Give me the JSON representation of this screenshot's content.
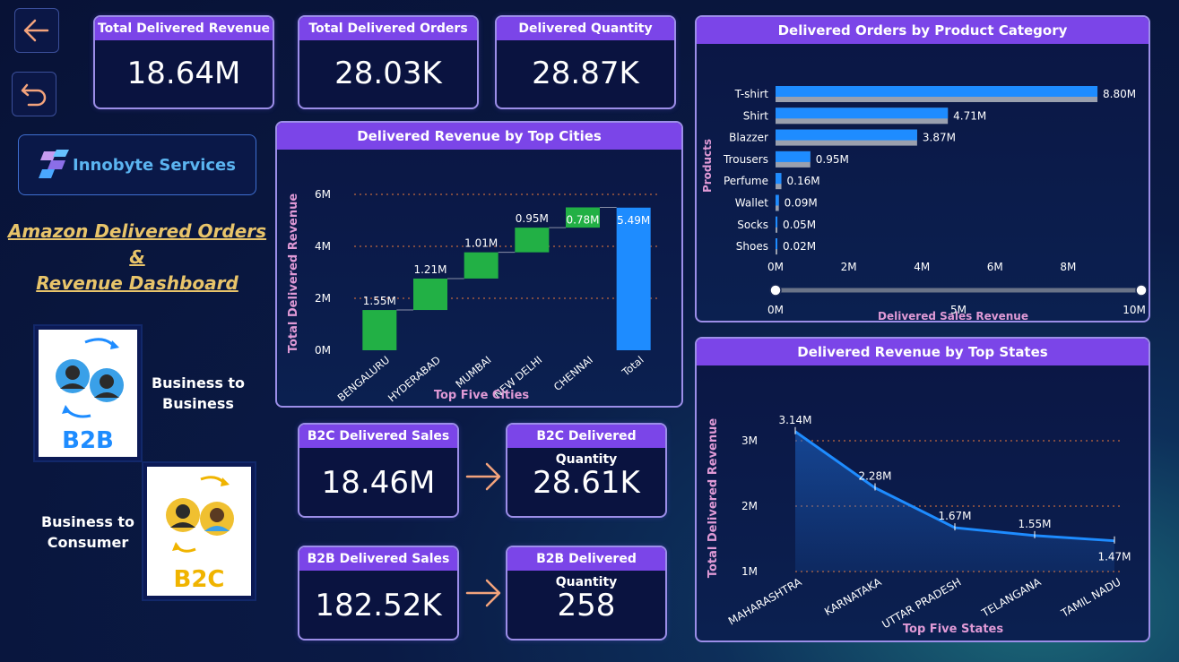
{
  "kpis": {
    "total_revenue": {
      "label": "Total Delivered Revenue",
      "value": "18.64M"
    },
    "total_orders": {
      "label": "Total Delivered Orders",
      "value": "28.03K"
    },
    "delivered_quantity": {
      "label": "Delivered Quantity",
      "value": "28.87K"
    },
    "b2c_sales": {
      "label": "B2C Delivered Sales",
      "value": "18.46M"
    },
    "b2c_quantity": {
      "label": "B2C Delivered Quantity",
      "value": "28.61K"
    },
    "b2b_sales": {
      "label": "B2B Delivered Sales",
      "value": "182.52K"
    },
    "b2b_quantity": {
      "label": "B2B Delivered Quantity",
      "value": "258"
    }
  },
  "brand": {
    "logo_text": "Innobyte Services"
  },
  "dashboard_title": {
    "line1": "Amazon Delivered Orders &",
    "line2": "Revenue Dashboard"
  },
  "b2b": {
    "badge": "B2B",
    "label_line1": "Business to",
    "label_line2": "Business"
  },
  "b2c": {
    "badge": "B2C",
    "label_line1": "Business to",
    "label_line2": "Consumer"
  },
  "colors": {
    "accent": "#7b45e8",
    "bar_blue": "#1e8cff",
    "bar_green": "#22b045",
    "gold": "#e8c46a"
  },
  "chart_data": [
    {
      "id": "cities",
      "type": "bar",
      "subtype": "waterfall",
      "title": "Delivered Revenue by Top Cities",
      "xlabel": "Top Five Cities",
      "ylabel": "Total Delivered Revenue",
      "categories": [
        "BENGALURU",
        "HYDERABAD",
        "MUMBAI",
        "NEW DELHI",
        "CHENNAI",
        "Total"
      ],
      "values": [
        1.55,
        1.21,
        1.01,
        0.95,
        0.78,
        5.49
      ],
      "labels": [
        "1.55M",
        "1.21M",
        "1.01M",
        "0.95M",
        "0.78M",
        "5.49M"
      ],
      "ylim": [
        0,
        6
      ],
      "yticks": [
        "0M",
        "2M",
        "4M",
        "6M"
      ]
    },
    {
      "id": "products",
      "type": "bar",
      "orientation": "horizontal",
      "title": "Delivered Orders by Product Category",
      "xlabel": "Delivered Sales Revenue",
      "ylabel": "Products",
      "categories": [
        "T-shirt",
        "Shirt",
        "Blazzer",
        "Trousers",
        "Perfume",
        "Wallet",
        "Socks",
        "Shoes"
      ],
      "values": [
        8.8,
        4.71,
        3.87,
        0.95,
        0.16,
        0.09,
        0.05,
        0.02
      ],
      "labels": [
        "8.80M",
        "4.71M",
        "3.87M",
        "0.95M",
        "0.16M",
        "0.09M",
        "0.05M",
        "0.02M"
      ],
      "xlim": [
        0,
        10
      ],
      "xticks": [
        "0M",
        "2M",
        "4M",
        "6M",
        "8M"
      ],
      "slider": {
        "min_label": "0M",
        "mid_label": "5M",
        "max_label": "10M"
      }
    },
    {
      "id": "states",
      "type": "area",
      "title": "Delivered Revenue by Top States",
      "xlabel": "Top Five States",
      "ylabel": "Total Delivered Revenue",
      "categories": [
        "MAHARASHTRA",
        "KARNATAKA",
        "UTTAR PRADESH",
        "TELANGANA",
        "TAMIL NADU"
      ],
      "values": [
        3.14,
        2.28,
        1.67,
        1.55,
        1.47
      ],
      "labels": [
        "3.14M",
        "2.28M",
        "1.67M",
        "1.55M",
        "1.47M"
      ],
      "ylim": [
        1,
        3.2
      ],
      "yticks": [
        "1M",
        "2M",
        "3M"
      ]
    }
  ]
}
